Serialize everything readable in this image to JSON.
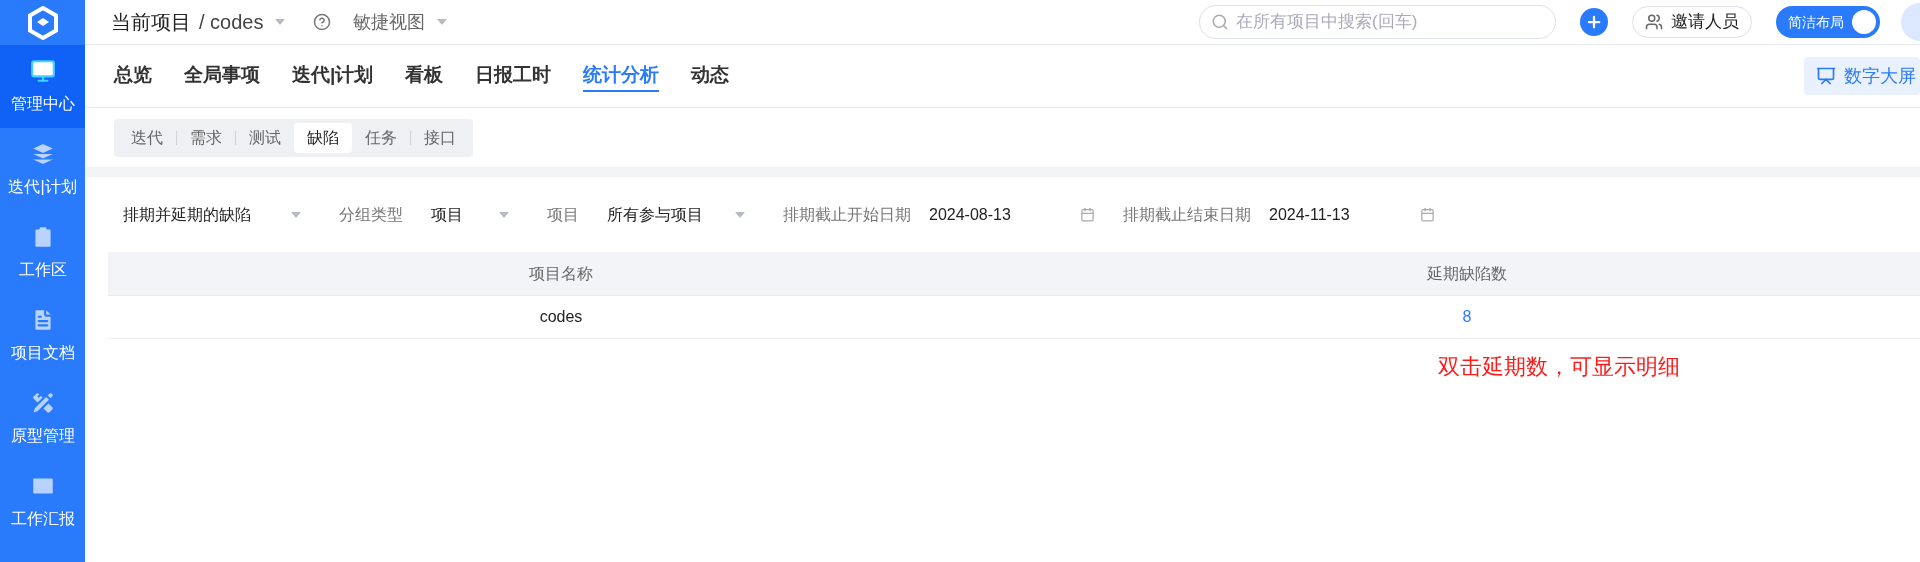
{
  "sidebar": {
    "items": [
      {
        "label": "管理中心",
        "selected": true
      },
      {
        "label": "迭代|计划",
        "selected": false
      },
      {
        "label": "工作区",
        "selected": false
      },
      {
        "label": "项目文档",
        "selected": false
      },
      {
        "label": "原型管理",
        "selected": false
      },
      {
        "label": "工作汇报",
        "selected": false
      }
    ]
  },
  "header": {
    "project": "当前项目",
    "project_name": "/ codes",
    "view": "敏捷视图",
    "search": {
      "placeholder": "在所有项目中搜索(回车)"
    },
    "invite": "邀请人员",
    "layout_toggle": {
      "label": "简洁布局",
      "on": true
    }
  },
  "nav_tabs": [
    {
      "label": "总览",
      "selected": false
    },
    {
      "label": "全局事项",
      "selected": false
    },
    {
      "label": "迭代|计划",
      "selected": false
    },
    {
      "label": "看板",
      "selected": false
    },
    {
      "label": "日报工时",
      "selected": false
    },
    {
      "label": "统计分析",
      "selected": true
    },
    {
      "label": "动态",
      "selected": false
    }
  ],
  "big_screen_button": "数字大屏",
  "sub_tabs": [
    {
      "label": "迭代",
      "selected": false
    },
    {
      "label": "需求",
      "selected": false
    },
    {
      "label": "测试",
      "selected": false
    },
    {
      "label": "缺陷",
      "selected": true
    },
    {
      "label": "任务",
      "selected": false
    },
    {
      "label": "接口",
      "selected": false
    }
  ],
  "filters": [
    {
      "kind": "select",
      "value": "排期并延期的缺陷"
    },
    {
      "kind": "select",
      "label": "分组类型",
      "value": "项目"
    },
    {
      "kind": "select",
      "label": "项目",
      "value": "所有参与项目"
    },
    {
      "kind": "date",
      "label": "排期截止开始日期",
      "value": "2024-08-13"
    },
    {
      "kind": "date",
      "label": "排期截止结束日期",
      "value": "2024-11-13"
    }
  ],
  "table": {
    "columns": [
      "项目名称",
      "延期缺陷数"
    ],
    "rows": [
      [
        "codes",
        "8"
      ]
    ]
  },
  "annotation": "双击延期数，可显示明细"
}
